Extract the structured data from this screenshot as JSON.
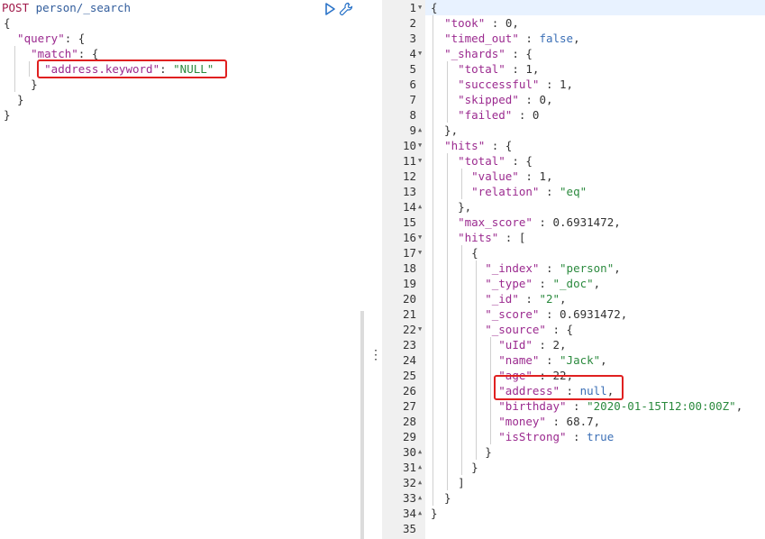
{
  "request": {
    "method": "POST",
    "path": "person/_search",
    "lines": [
      "{",
      "  \"query\": {",
      "    \"match\": {",
      "      \"address.keyword\": \"NULL\"",
      "    }",
      "  }",
      "}"
    ]
  },
  "toolbar": {
    "run_icon": "play-icon",
    "settings_icon": "wrench-icon"
  },
  "response": {
    "line_numbers": [
      "1",
      "2",
      "3",
      "4",
      "5",
      "6",
      "7",
      "8",
      "9",
      "10",
      "11",
      "12",
      "13",
      "14",
      "15",
      "16",
      "17",
      "18",
      "19",
      "20",
      "21",
      "22",
      "23",
      "24",
      "25",
      "26",
      "27",
      "28",
      "29",
      "30",
      "31",
      "32",
      "33",
      "34",
      "35"
    ],
    "fold_lines": [
      1,
      4,
      9,
      10,
      11,
      14,
      16,
      17,
      22,
      30,
      31,
      32,
      33,
      34
    ],
    "lines": [
      "{",
      "  \"took\" : 0,",
      "  \"timed_out\" : false,",
      "  \"_shards\" : {",
      "    \"total\" : 1,",
      "    \"successful\" : 1,",
      "    \"skipped\" : 0,",
      "    \"failed\" : 0",
      "  },",
      "  \"hits\" : {",
      "    \"total\" : {",
      "      \"value\" : 1,",
      "      \"relation\" : \"eq\"",
      "    },",
      "    \"max_score\" : 0.6931472,",
      "    \"hits\" : [",
      "      {",
      "        \"_index\" : \"person\",",
      "        \"_type\" : \"_doc\",",
      "        \"_id\" : \"2\",",
      "        \"_score\" : 0.6931472,",
      "        \"_source\" : {",
      "          \"uId\" : 2,",
      "          \"name\" : \"Jack\",",
      "          \"age\" : 22,",
      "          \"address\" : null,",
      "          \"birthday\" : \"2020-01-15T12:00:00Z\",",
      "          \"money\" : 68.7,",
      "          \"isStrong\" : true",
      "        }",
      "      }",
      "    ]",
      "  }",
      "}",
      ""
    ]
  },
  "colors": {
    "highlight_border": "#e02020",
    "key": "#9b2a8f",
    "string": "#2b8a3e",
    "method": "#a01a4a",
    "gutter_bg": "#f0f0f0"
  }
}
